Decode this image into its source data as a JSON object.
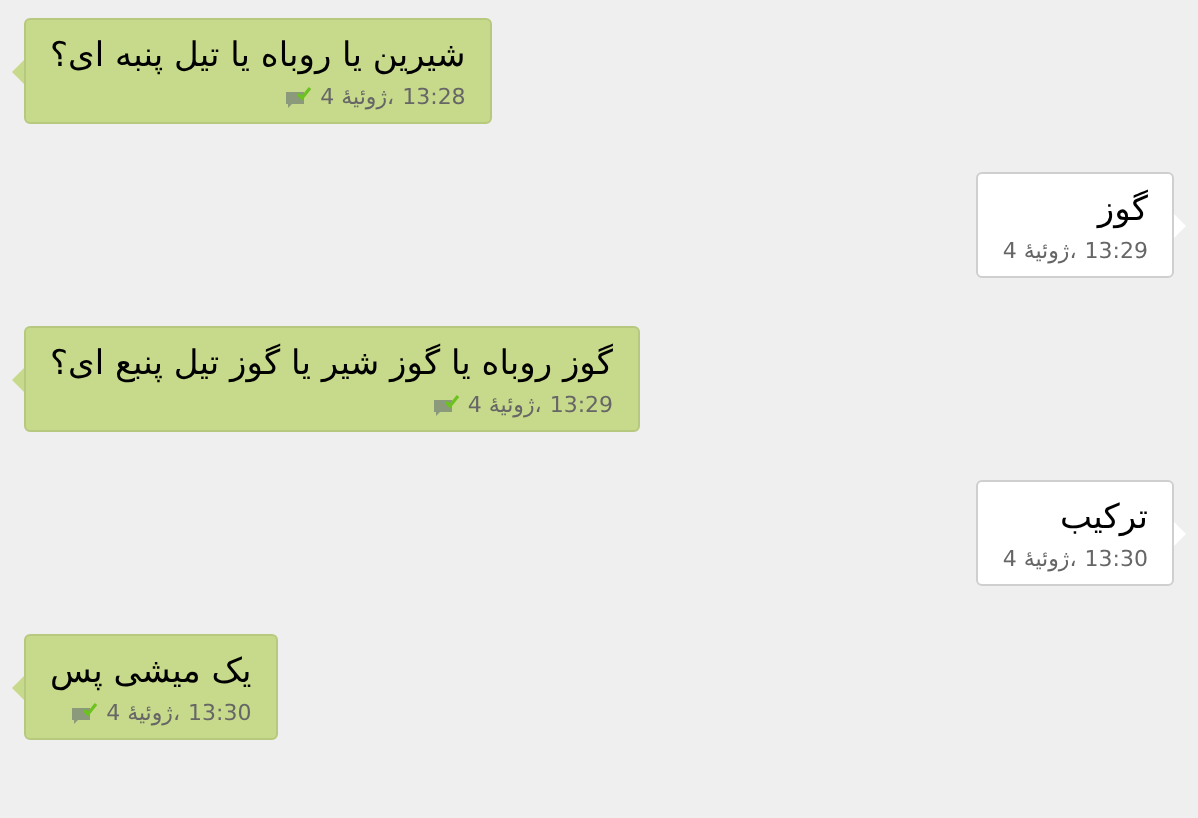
{
  "messages": [
    {
      "kind": "outgoing",
      "text": "شیرین یا روباه یا تیل پنبه ای؟",
      "date": "4 ژوئیهٔ،",
      "time": "13:28"
    },
    {
      "kind": "incoming",
      "text": "گوز",
      "date": "4 ژوئیهٔ،",
      "time": "13:29"
    },
    {
      "kind": "outgoing",
      "text": "گوز روباه یا گوز شیر یا گوز تیل پنبع ای؟",
      "date": "4 ژوئیهٔ،",
      "time": "13:29"
    },
    {
      "kind": "incoming",
      "text": "ترکیب",
      "date": "4 ژوئیهٔ،",
      "time": "13:30"
    },
    {
      "kind": "outgoing",
      "text": "یک میشی پس",
      "date": "4 ژوئیهٔ،",
      "time": "13:30"
    }
  ]
}
